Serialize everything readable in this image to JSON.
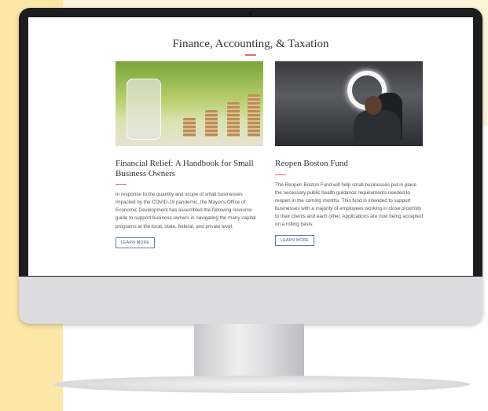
{
  "page": {
    "section_title": "Finance, Accounting, & Taxation"
  },
  "cards": [
    {
      "title": "Financial Relief: A Handbook for Small Business Owners",
      "body": "In response to the quantity and scope of small businesses impacted by the COVID-19 pandemic, the Mayor's Office of Economic Development has assembled the following resource guide to support business owners in navigating the many capital programs at the local, state, federal, and private level.",
      "button": "LEARN MORE",
      "image": "jar-of-coins-with-sprouts"
    },
    {
      "title": "Reopen Boston Fund",
      "body": "The Reopen Boston Fund will help small businesses put in place the necessary public health guidance requirements needed to reopen in the coming months. This fund is intended to support businesses with a majority of employees working in close proximity to their clients and each other. Applications are now being accepted on a rolling basis.",
      "button": "LEARN MORE",
      "image": "barbershop-with-ring-light"
    }
  ],
  "colors": {
    "accent_rule": "#e26b6b",
    "button_border": "#5b7da8",
    "background_yellow": "#fde7a7"
  }
}
